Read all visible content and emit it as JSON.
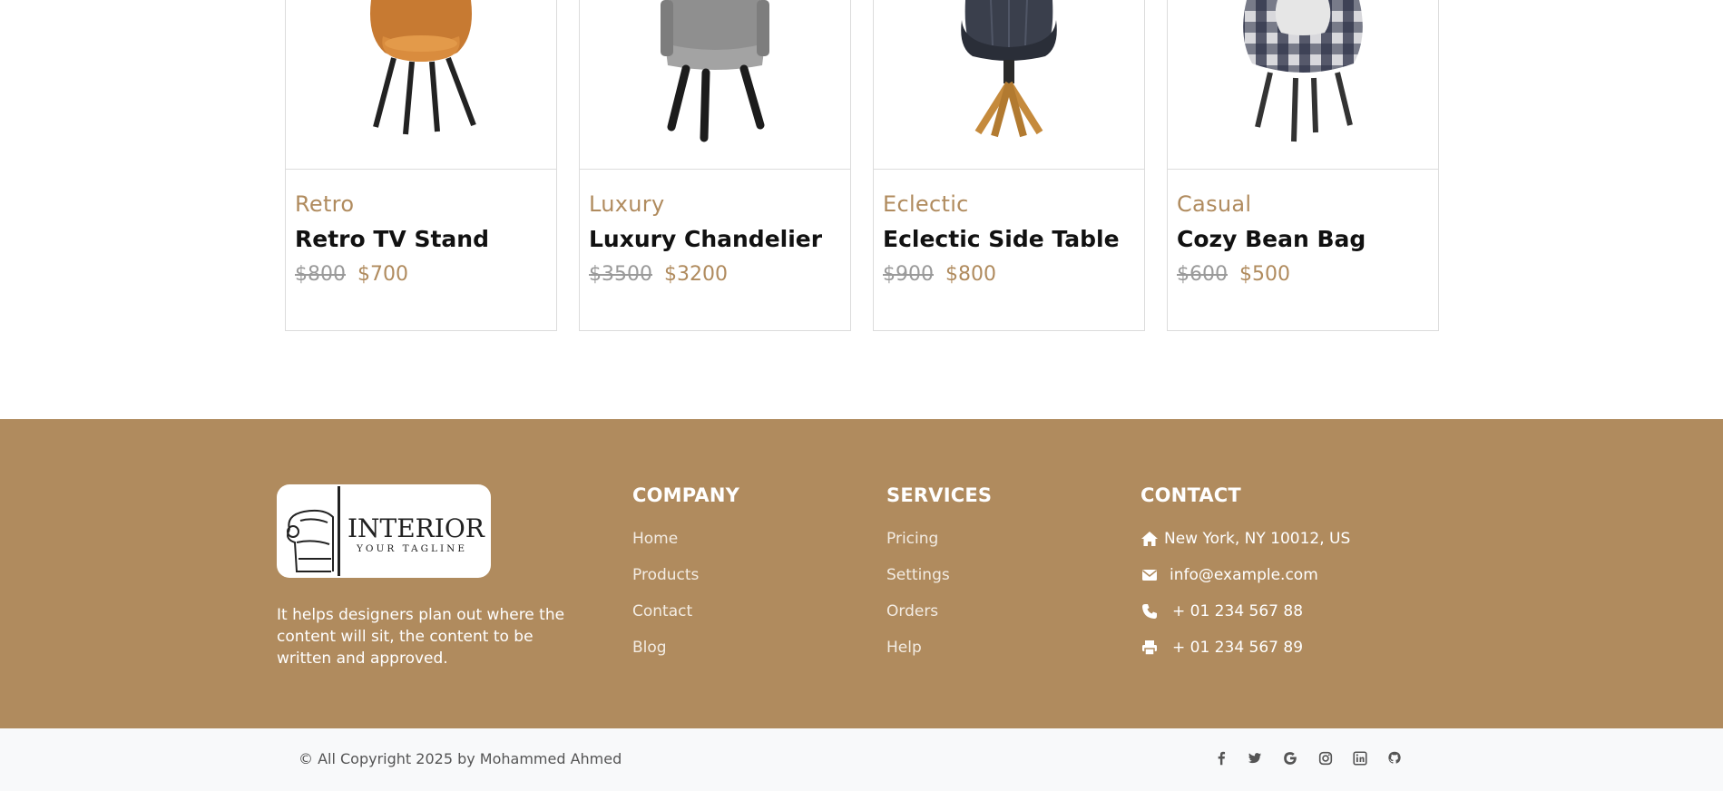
{
  "products": [
    {
      "category": "Retro",
      "name": "Retro TV Stand",
      "old_price": "$800",
      "price": "$700",
      "image": "orange-armchair"
    },
    {
      "category": "Luxury",
      "name": "Luxury Chandelier",
      "old_price": "$3500",
      "price": "$3200",
      "image": "gray-chair"
    },
    {
      "category": "Eclectic",
      "name": "Eclectic Side Table",
      "old_price": "$900",
      "price": "$800",
      "image": "navy-swivel-chair"
    },
    {
      "category": "Casual",
      "name": "Cozy Bean Bag",
      "old_price": "$600",
      "price": "$500",
      "image": "plaid-armchair"
    }
  ],
  "footer": {
    "logo": {
      "brand": "INTERIOR",
      "tagline": "YOUR TAGLINE"
    },
    "about": "It helps designers plan out where the content will sit, the content to be written and approved.",
    "company": {
      "heading": "COMPANY",
      "links": [
        "Home",
        "Products",
        "Contact",
        "Blog"
      ]
    },
    "services": {
      "heading": "SERVICES",
      "links": [
        "Pricing",
        "Settings",
        "Orders",
        "Help"
      ]
    },
    "contact": {
      "heading": "CONTACT",
      "items": [
        {
          "icon": "home-icon",
          "text": "New York, NY 10012, US"
        },
        {
          "icon": "envelope-icon",
          "text": "info@example.com"
        },
        {
          "icon": "phone-icon",
          "text": "+ 01 234 567 88"
        },
        {
          "icon": "print-icon",
          "text": "+ 01 234 567 89"
        }
      ]
    },
    "colors": {
      "background": "#b08b5e",
      "accent": "#b08b5e"
    }
  },
  "bottom_bar": {
    "copyright": "© All Copyright 2025 by Mohammed Ahmed",
    "social": [
      "facebook-icon",
      "twitter-icon",
      "google-icon",
      "instagram-icon",
      "linkedin-icon",
      "github-icon"
    ]
  }
}
